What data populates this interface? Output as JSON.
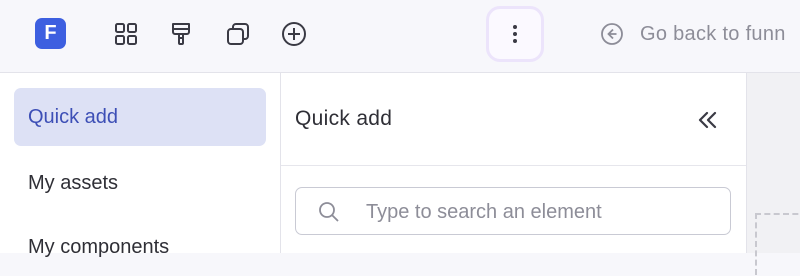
{
  "app": {
    "logo_letter": "F"
  },
  "toolbar": {
    "tools": [
      {
        "icon": "grid-icon"
      },
      {
        "icon": "paint-roller-icon"
      },
      {
        "icon": "copy-pages-icon"
      },
      {
        "icon": "plus-circle-icon"
      }
    ],
    "more_icon": "vertical-dots-icon",
    "back_label": "Go back to funn",
    "back_icon": "arrow-left-circle-icon"
  },
  "nav": {
    "items": [
      {
        "label": "Quick add",
        "active": true
      },
      {
        "label": "My assets",
        "active": false
      },
      {
        "label": "My components",
        "active": false
      }
    ]
  },
  "panel": {
    "title": "Quick add",
    "collapse_icon": "double-chevron-left-icon",
    "search": {
      "placeholder": "Type to search an element",
      "value": ""
    }
  },
  "colors": {
    "accent": "#3d5fe0",
    "active_nav_bg": "#dde1f5",
    "active_nav_text": "#3d4fb6"
  }
}
